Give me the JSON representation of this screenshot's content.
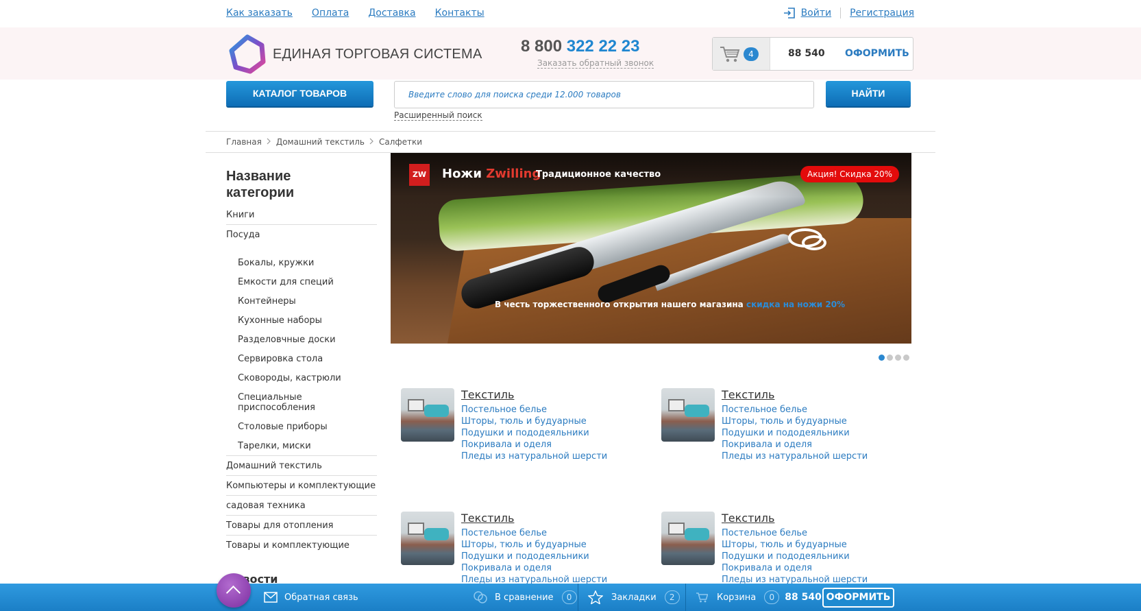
{
  "topnav": {
    "links": [
      "Как заказать",
      "Оплата",
      "Доставка",
      "Контакты"
    ],
    "login": "Войти",
    "register": "Регистрация"
  },
  "header": {
    "logo_text": "ЕДИНАЯ ТОРГОВАЯ СИСТЕМА",
    "phone_prefix": "8 800",
    "phone_number": "322 22 23",
    "callback": "Заказать обратный звонок",
    "cart": {
      "count": "4",
      "sum": "88 540",
      "checkout": "ОФОРМИТЬ"
    }
  },
  "search": {
    "catalog_label": "КАТАЛОГ ТОВАРОВ",
    "placeholder": "Введите слово для поиска среди 12.000 товаров",
    "find_label": "НАЙТИ",
    "advanced": "Расширенный поиск"
  },
  "breadcrumb": [
    "Главная",
    "Домашний текстиль",
    "Салфетки"
  ],
  "sidebar": {
    "title": "Название категории",
    "items_top": [
      "Книги",
      "Посуда"
    ],
    "subitems": [
      "Бокалы, кружки",
      "Емкости для специй",
      "Контейнеры",
      "Кухонные наборы",
      "Разделовчные доски",
      "Сервировка стола",
      "Сковороды, кастрюли",
      "Специальные приспособления",
      "Столовые приборы",
      "Тарелки, миски"
    ],
    "items_bottom": [
      "Домашний текстиль",
      "Компьютеры и комплектующие",
      "садовая техника",
      "Товары для отопления",
      "Товары и комплектующие"
    ],
    "news": "Новости"
  },
  "banner": {
    "brand_prefix": "Ножи",
    "brand_name": "Zwilling",
    "tagline": "Традиционное качество",
    "badge": "Акция! Скидка 20%",
    "caption": "В честь торжественного открытия нашего магазина",
    "caption_link": "скидка на ножи 20%",
    "logo_glyph": "ZW",
    "slides_total": 4,
    "slide_active": 1
  },
  "categories": [
    {
      "title": "Текстиль",
      "links": [
        "Постельное белье",
        "Шторы, тюль и будуарные",
        "Подушки и пододеяльники",
        "Покривала и оделя",
        "Пледы из натуральной шерсти"
      ]
    },
    {
      "title": "Текстиль",
      "links": [
        "Постельное белье",
        "Шторы, тюль и будуарные",
        "Подушки и пододеяльники",
        "Покривала и оделя",
        "Пледы из натуральной шерсти"
      ]
    },
    {
      "title": "Текстиль",
      "links": [
        "Постельное белье",
        "Шторы, тюль и будуарные",
        "Подушки и пододеяльники",
        "Покривала и оделя",
        "Пледы из натуральной шерсти"
      ]
    },
    {
      "title": "Текстиль",
      "links": [
        "Постельное белье",
        "Шторы, тюль и будуарные",
        "Подушки и пододеяльники",
        "Покривала и оделя",
        "Пледы из натуральной шерсти"
      ]
    }
  ],
  "bottombar": {
    "feedback": "Обратная связь",
    "compare": "В сравнение",
    "compare_count": "0",
    "bookmarks": "Закладки",
    "bookmarks_count": "2",
    "cart": "Корзина",
    "cart_count": "0",
    "cart_sum": "88 540",
    "checkout": "ОФОРМИТЬ"
  },
  "colors": {
    "accent": "#1f86d0",
    "badge_red": "#e30b0b",
    "bottombar": "#2590d6"
  }
}
